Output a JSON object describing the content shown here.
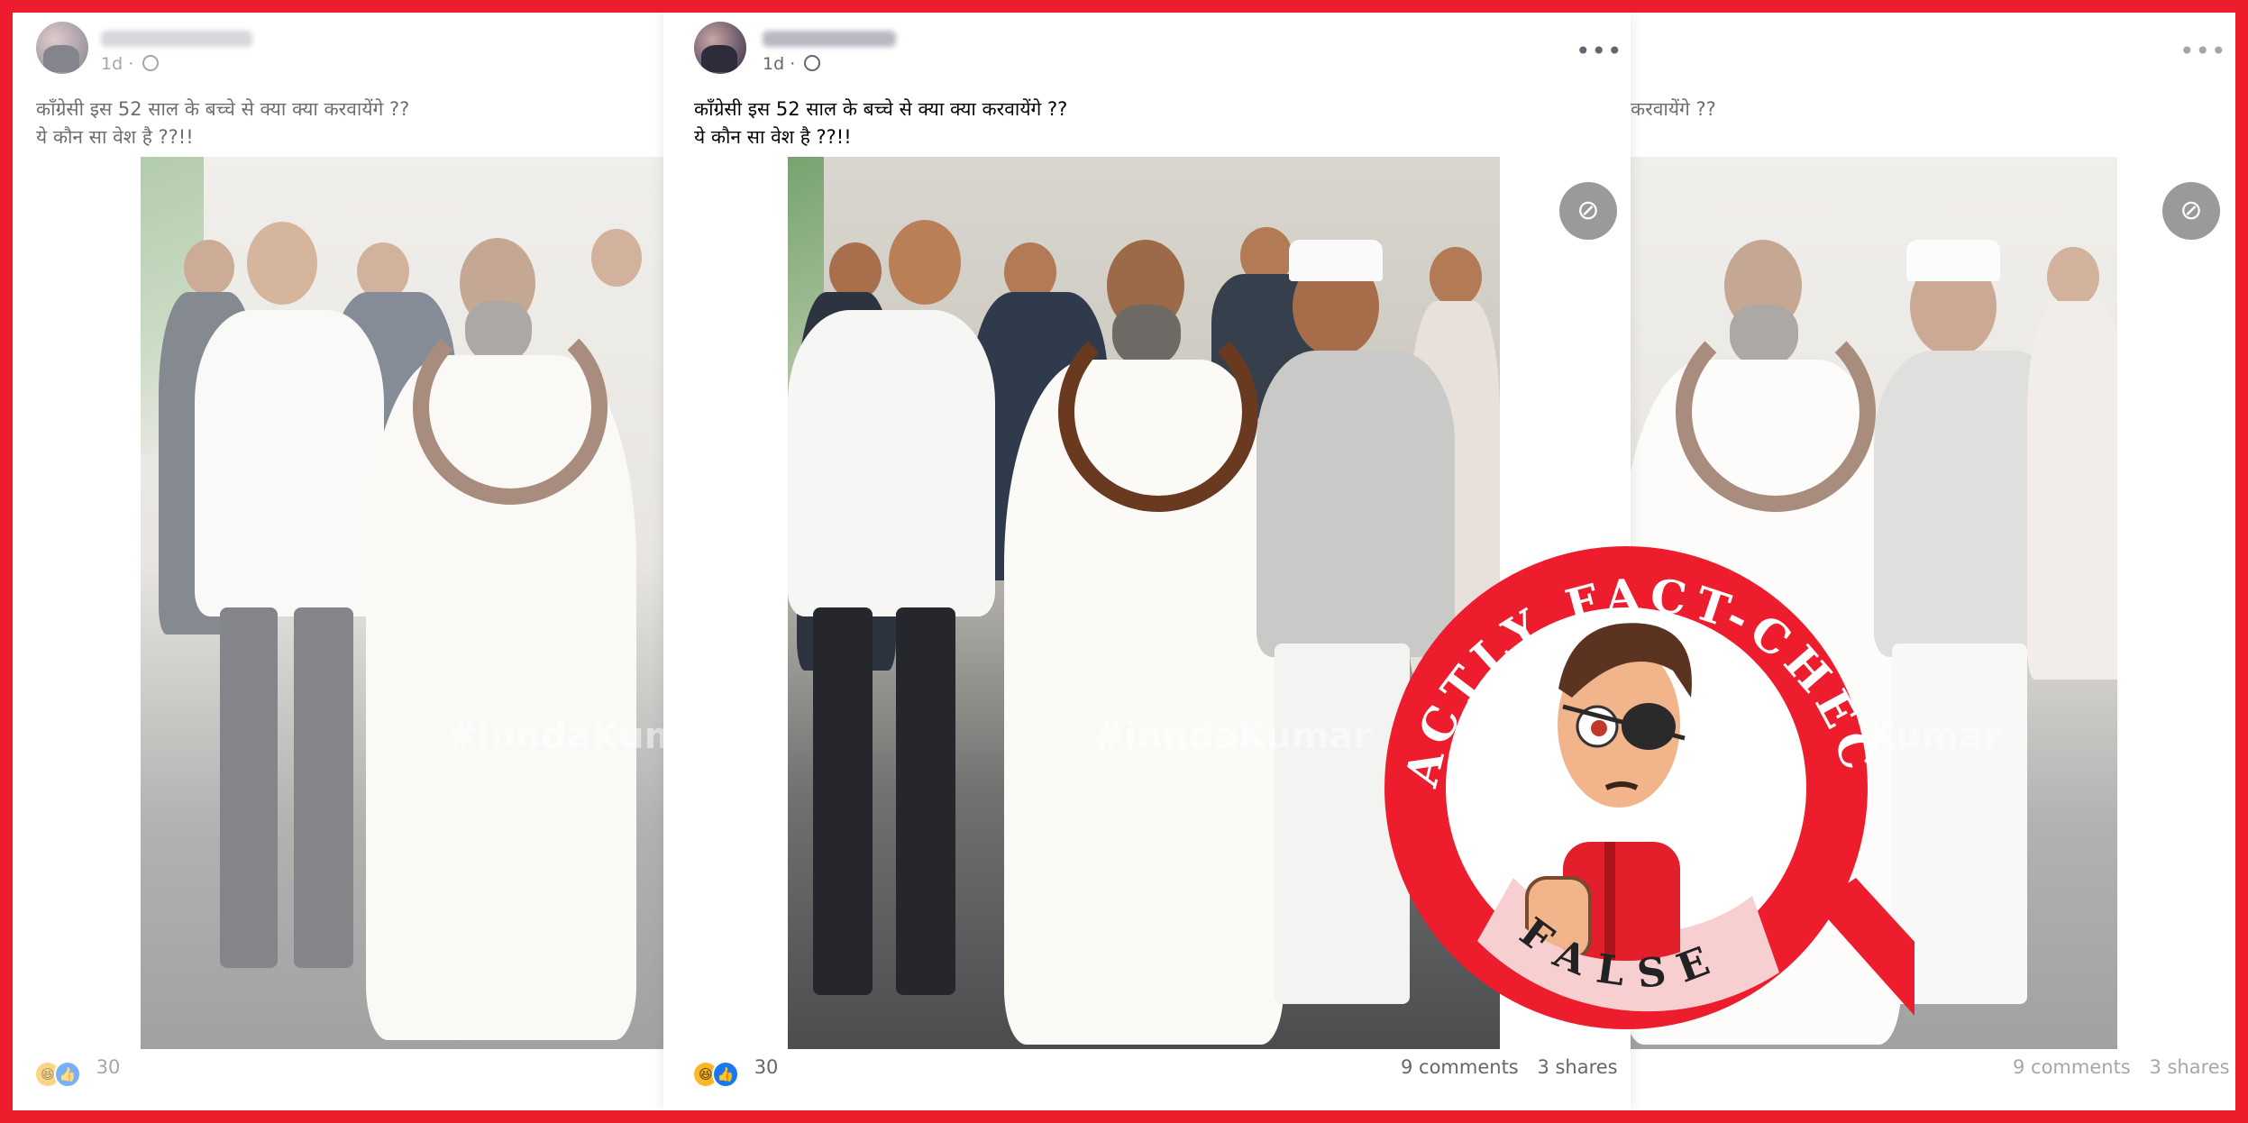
{
  "post": {
    "time": "1d",
    "caption_line1": "कॉंग्रेसी इस 52 साल के बच्चे से क्या क्या करवायेंगे ??",
    "caption_line2": "ये कौन सा वेश है ??!!",
    "caption_clipped": "करवायेंगे ??",
    "reaction_count": "30",
    "comments": "9 comments",
    "shares": "3 shares",
    "more_icon": "•••",
    "watermark": "#inndaKumar",
    "watermark_clipped": "#innda Kumar"
  },
  "icons": {
    "privacy": "globe-icon",
    "reactions": [
      "haha-icon",
      "like-icon"
    ],
    "hidden": "eye-slash-icon"
  },
  "badge": {
    "top_text": "FACTLY FACT-CHECK",
    "verdict": "FALSE",
    "ring_color": "#ee1d2d",
    "verdict_bg": "#f7cfd0"
  }
}
